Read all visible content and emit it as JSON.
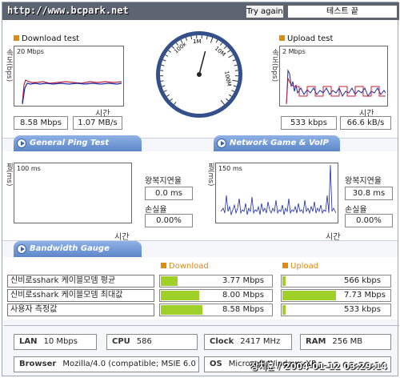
{
  "header": {
    "site": "http://www.bcpark.net",
    "try_again": "Try again",
    "end_test": "테스트 끝"
  },
  "download": {
    "title": "Download test",
    "unit_label": "속도(bps)",
    "scale": "20 Mbps",
    "time_label": "시간",
    "mbps": "8.58 Mbps",
    "mbs": "1.07 MB/s"
  },
  "upload": {
    "title": "Upload test",
    "unit_label": "속도(bps)",
    "scale": "2 Mbps",
    "time_label": "시간",
    "kbps": "533 kbps",
    "kbs": "66.6 kB/s"
  },
  "gauge": {
    "ticks": [
      "100k",
      "1M",
      "10M",
      "100M"
    ],
    "needle_value_mbps": 8.58
  },
  "ping": {
    "tab": "General Ping Test",
    "unit_label": "핑(ms)",
    "scale": "100 ms",
    "time_label": "시간",
    "rtt_label": "왕복지연율",
    "rtt": "0.0 ms",
    "loss_label": "손실율",
    "loss": "0.00%"
  },
  "game": {
    "tab": "Network Game & VoIP Test",
    "unit_label": "핑(ms)",
    "scale": "150 ms",
    "time_label": "시간",
    "rtt_label": "왕복지연율",
    "rtt": "30.8 ms",
    "loss_label": "손실율",
    "loss": "0.00%"
  },
  "bandwidth": {
    "tab": "Bandwidth Gauge",
    "download_header": "Download",
    "upload_header": "Upload",
    "rows": [
      {
        "name": "신비로sshark 케이블모뎀 평균",
        "down": "3.77 Mbps",
        "down_level": 0.3,
        "up": "566 kbps",
        "up_level": 0.06
      },
      {
        "name": "신비로sshark 케이블모뎀 최대값",
        "down": "8.00 Mbps",
        "down_level": 0.68,
        "up": "7.73 Mbps",
        "up_level": 0.95
      },
      {
        "name": "사용자 측정값",
        "down": "8.58 Mbps",
        "down_level": 0.74,
        "up": "533 kbps",
        "up_level": 0.06
      }
    ]
  },
  "sysinfo": {
    "lan_label": "LAN",
    "lan": "10 Mbps",
    "cpu_label": "CPU",
    "cpu": "586",
    "clock_label": "Clock",
    "clock": "2417 MHz",
    "ram_label": "RAM",
    "ram": "256 MB",
    "browser_label": "Browser",
    "browser": "Mozilla/4.0 (compatible; MSIE 6.0",
    "os_label": "OS",
    "os": "Microsoft Windows XP"
  },
  "watermark": "장치훈 / 2004-01-12 03:29:14",
  "colors": {
    "download_line_blue": "#1a2aa8",
    "download_line_red": "#c0203a",
    "bar_green": "#9fd02a",
    "tab_blue": "#5d86c8",
    "accent_orange": "#e08a10"
  }
}
